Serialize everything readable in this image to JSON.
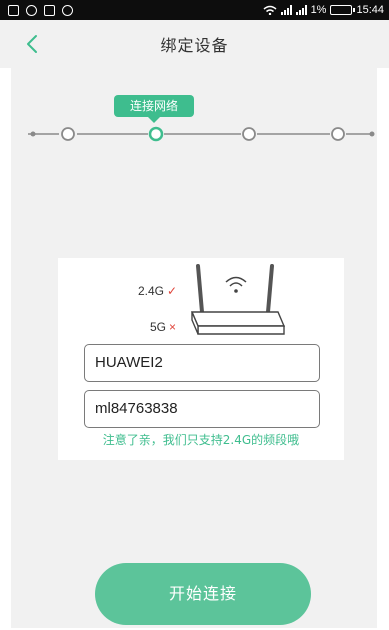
{
  "status_bar": {
    "battery": "1%",
    "time": "15:44"
  },
  "header": {
    "title": "绑定设备",
    "back_icon": "chevron-left-icon"
  },
  "stepper": {
    "current_step_label": "连接网络",
    "total_steps": 4,
    "current_step": 2,
    "accent_color": "#3ebd8e",
    "line_color": "#8a8a8a"
  },
  "bands": {
    "band_24_label": "2.4G",
    "band_24_mark": "✓",
    "band_5_label": "5G",
    "band_5_mark": "×"
  },
  "form": {
    "ssid_value": "HUAWEI2",
    "password_value": "ml84763838",
    "hint": "注意了亲，我们只支持2.4G的频段哦"
  },
  "actions": {
    "start_label": "开始连接",
    "button_color": "#5cc49a"
  }
}
